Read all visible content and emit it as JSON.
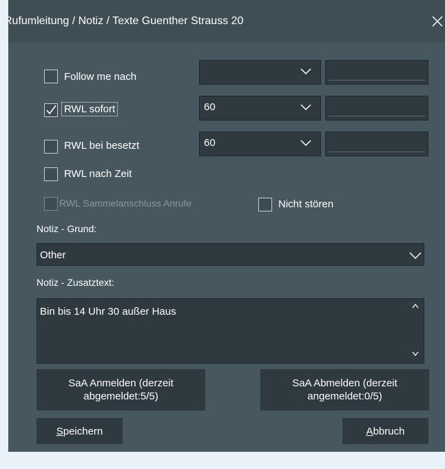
{
  "window": {
    "title": "Rufumleitung / Notiz / Texte Guenther Strauss 20"
  },
  "options": {
    "follow_me": {
      "label": "Follow me nach",
      "checked": false,
      "select_value": ""
    },
    "rwl_sofort": {
      "label": "RWL sofort",
      "checked": true,
      "select_value": "60"
    },
    "rwl_besetzt": {
      "label": "RWL bei besetzt",
      "checked": false,
      "select_value": "60"
    },
    "rwl_zeit": {
      "label": "RWL nach Zeit",
      "checked": false
    },
    "rwl_sammel": {
      "label": "RWL Sammelanschluss Anrufe",
      "checked": false,
      "disabled": true
    },
    "nicht_stoeren": {
      "label": "Nicht stören",
      "checked": false
    }
  },
  "notiz": {
    "grund_label": "Notiz - Grund:",
    "grund_value": "Other",
    "zusatz_label": "Notiz - Zusatztext:",
    "zusatz_value": "Bin bis 14 Uhr 30 außer Haus"
  },
  "buttons": {
    "saa_anmelden": {
      "line1": "SaA Anmelden (derzeit",
      "line2": "abgemeldet:5/5)"
    },
    "saa_abmelden": {
      "line1": "SaA Abmelden (derzeit",
      "line2": "angemeldet:0/5)"
    },
    "speichern": {
      "mnemonic": "S",
      "rest": "peichern"
    },
    "abbruch": {
      "mnemonic": "A",
      "rest": "bbruch"
    }
  },
  "icons": {
    "close": "close-icon",
    "dropdown": "chevron-down-icon",
    "scroll_up": "chevron-up-icon",
    "scroll_down": "chevron-down-icon"
  },
  "colors": {
    "window_bg": "#46575f",
    "titlebar_bg": "#3f4e55",
    "control_bg": "#2e3a40",
    "text": "#ffffff",
    "disabled_text": "#8c979c"
  }
}
